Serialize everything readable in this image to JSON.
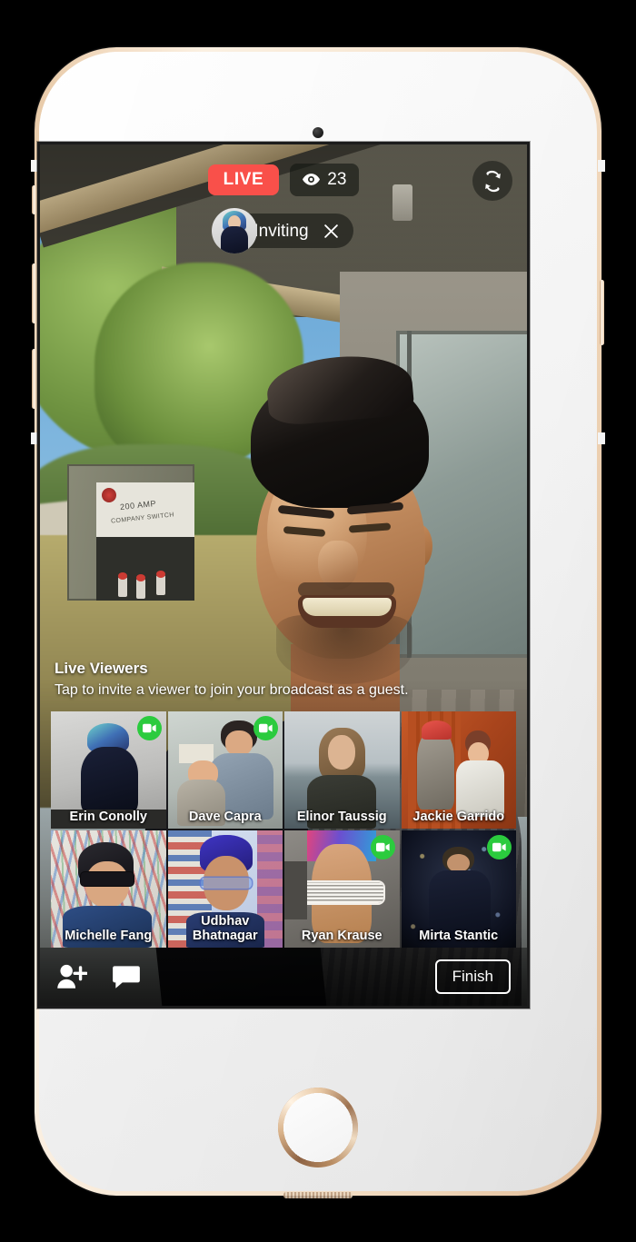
{
  "app": {
    "screen_title": "Facebook Live broadcast - invite viewers"
  },
  "top_bar": {
    "live_label": "LIVE",
    "viewer_count": "23",
    "eye_icon": "eye-icon",
    "flip_camera_icon": "camera-flip-icon"
  },
  "invite_status": {
    "label": "Inviting",
    "close_icon": "close-x-icon",
    "avatar_icon": "avatar-inviting"
  },
  "viewers_panel": {
    "title": "Live Viewers",
    "subtitle": "Tap to invite a viewer to join your broadcast as a guest.",
    "viewers": [
      {
        "name": "Erin Conolly",
        "has_video": true,
        "art": "a-erin"
      },
      {
        "name": "Dave Capra",
        "has_video": true,
        "art": "a-dave"
      },
      {
        "name": "Elinor Taussig",
        "has_video": false,
        "art": "a-elinor"
      },
      {
        "name": "Jackie Garrido",
        "has_video": false,
        "art": "a-jackie"
      },
      {
        "name": "Michelle Fang",
        "has_video": false,
        "art": "a-michelle"
      },
      {
        "name": "Udbhav Bhatnagar",
        "has_video": false,
        "art": "a-udbhav"
      },
      {
        "name": "Ryan Krause",
        "has_video": true,
        "art": "a-ryan"
      },
      {
        "name": "Mirta Stantic",
        "has_video": true,
        "art": "a-mirta"
      }
    ],
    "video_badge_icon": "video-camera-icon"
  },
  "toolbar": {
    "add_person_icon": "add-person-icon",
    "comment_icon": "comment-bubble-icon",
    "finish_label": "Finish"
  },
  "background_scene": {
    "sign_line1": "200 AMP",
    "sign_line2": "COMPANY SWITCH"
  },
  "colors": {
    "live_red": "#f9504a",
    "video_green": "#2bcb3e",
    "overlay_dark": "rgba(20,22,18,0.6)"
  }
}
